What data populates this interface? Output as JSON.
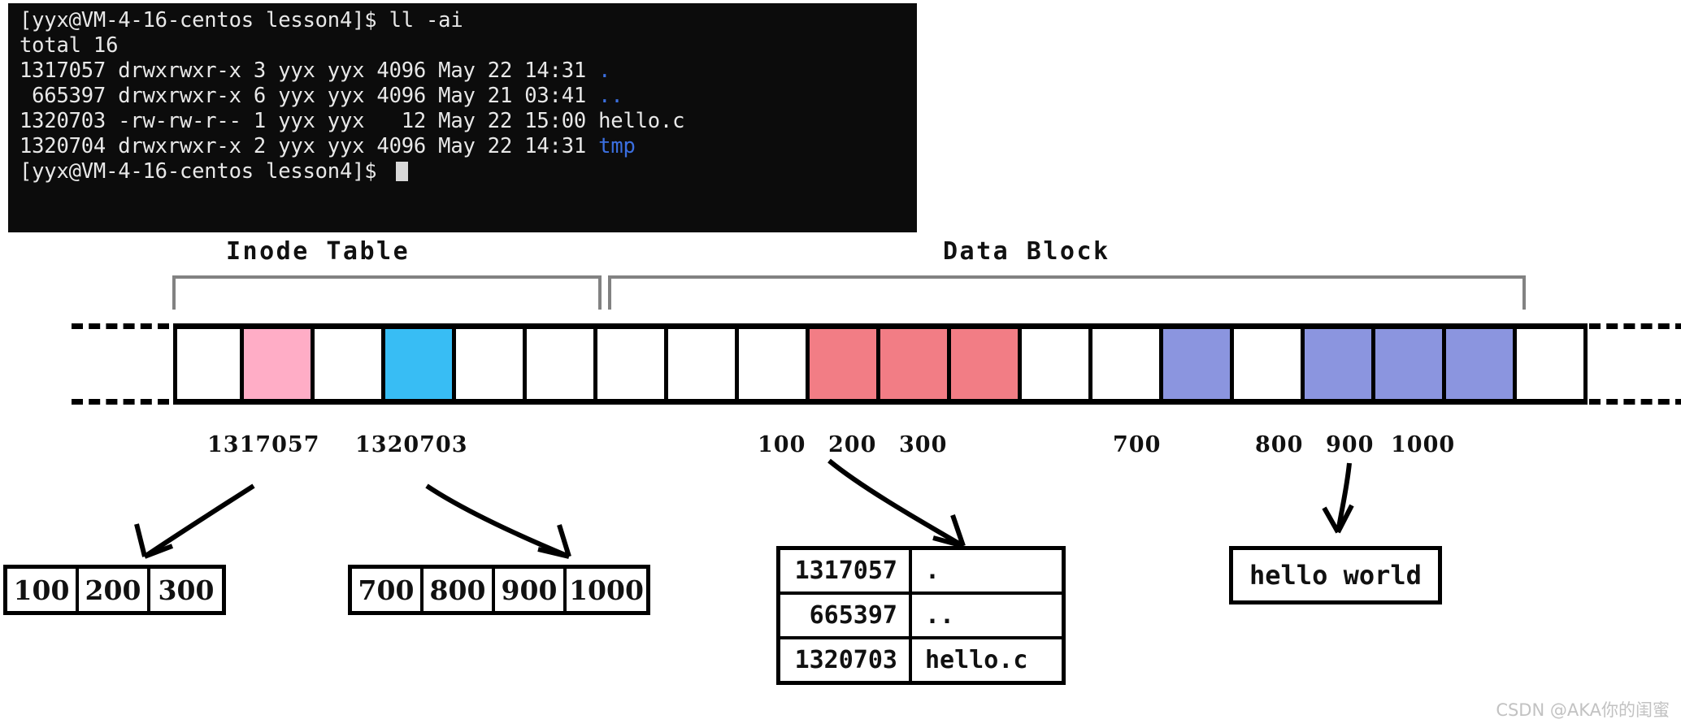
{
  "terminal": {
    "lines": [
      {
        "text": "[yyx@VM-4-16-centos lesson4]$ ll -ai"
      },
      {
        "text": "total 16"
      },
      {
        "text": "1317057 drwxrwxr-x 3 yyx yyx 4096 May 22 14:31 ",
        "suffix": ".",
        "suffix_color": "blue"
      },
      {
        "text": " 665397 drwxrwxr-x 6 yyx yyx 4096 May 21 03:41 ",
        "suffix": "..",
        "suffix_color": "blue"
      },
      {
        "text": "1320703 -rw-rw-r-- 1 yyx yyx   12 May 22 15:00 hello.c"
      },
      {
        "text": "1320704 drwxrwxr-x 2 yyx yyx 4096 May 22 14:31 ",
        "suffix": "tmp",
        "suffix_color": "blue"
      },
      {
        "text": "[yyx@VM-4-16-centos lesson4]$ ",
        "cursor": true
      }
    ],
    "prompt": "[yyx@VM-4-16-centos lesson4]$",
    "command": "ll -ai",
    "total_line": "total 16"
  },
  "diagram": {
    "inode_table_label": "Inode Table",
    "data_block_label": "Data Block",
    "strip_cells": [
      {
        "index": 0,
        "color": "white"
      },
      {
        "index": 1,
        "color": "pink",
        "label": "1317057"
      },
      {
        "index": 2,
        "color": "white"
      },
      {
        "index": 3,
        "color": "cyan",
        "label": "1320703"
      },
      {
        "index": 4,
        "color": "white"
      },
      {
        "index": 5,
        "color": "white"
      },
      {
        "index": 6,
        "color": "white"
      },
      {
        "index": 7,
        "color": "white"
      },
      {
        "index": 8,
        "color": "white"
      },
      {
        "index": 9,
        "color": "red",
        "label": "100"
      },
      {
        "index": 10,
        "color": "red",
        "label": "200"
      },
      {
        "index": 11,
        "color": "red",
        "label": "300"
      },
      {
        "index": 12,
        "color": "white"
      },
      {
        "index": 13,
        "color": "white"
      },
      {
        "index": 14,
        "color": "purple",
        "label": "700"
      },
      {
        "index": 15,
        "color": "white"
      },
      {
        "index": 16,
        "color": "purple",
        "label": "800"
      },
      {
        "index": 17,
        "color": "purple",
        "label": "900"
      },
      {
        "index": 18,
        "color": "purple",
        "label": "1000"
      },
      {
        "index": 19,
        "color": "white"
      }
    ],
    "inode_labels": [
      "1317057",
      "1320703"
    ],
    "data_labels_group_a": [
      "100",
      "200",
      "300"
    ],
    "data_labels_group_b": [
      "700"
    ],
    "data_labels_group_c": [
      "800",
      "900",
      "1000"
    ],
    "block_list_dir": [
      "100",
      "200",
      "300"
    ],
    "block_list_file": [
      "700",
      "800",
      "900",
      "1000"
    ],
    "dir_entries": [
      {
        "inode": "1317057",
        "name": "."
      },
      {
        "inode": "665397",
        "name": ".."
      },
      {
        "inode": "1320703",
        "name": "hello.c"
      }
    ],
    "file_content": "hello world"
  },
  "colors": {
    "pink": "#FFADC6",
    "cyan": "#38BDF4",
    "red": "#F27D85",
    "purple": "#8B95DF",
    "bracket_gray": "#828282",
    "terminal_bg": "#0c0c0c",
    "terminal_fg": "#e8e8e8",
    "terminal_blue": "#3b6fe0"
  },
  "watermark": "CSDN @AKA你的闺蜜"
}
